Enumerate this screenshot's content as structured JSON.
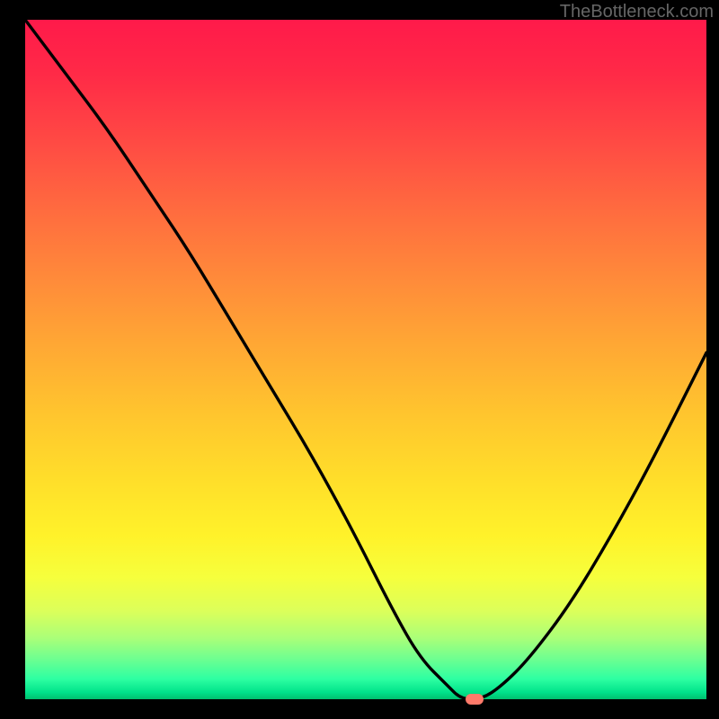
{
  "watermark": "TheBottleneck.com",
  "chart_data": {
    "type": "line",
    "title": "",
    "xlabel": "",
    "ylabel": "",
    "xlim": [
      0,
      100
    ],
    "ylim": [
      0,
      100
    ],
    "grid": false,
    "legend": "none",
    "background_gradient": {
      "direction": "vertical",
      "stops": [
        {
          "pos": 0,
          "color": "#ff1a4a"
        },
        {
          "pos": 50,
          "color": "#ffb030"
        },
        {
          "pos": 80,
          "color": "#fff22a"
        },
        {
          "pos": 95,
          "color": "#6fff90"
        },
        {
          "pos": 100,
          "color": "#00c06e"
        }
      ]
    },
    "series": [
      {
        "name": "bottleneck-curve",
        "color": "#000000",
        "x": [
          0,
          6,
          12,
          18,
          24,
          30,
          36,
          42,
          48,
          54,
          58,
          62,
          64,
          67,
          70,
          74,
          80,
          86,
          92,
          100
        ],
        "y": [
          100,
          92,
          84,
          75,
          66,
          56,
          46,
          36,
          25,
          13,
          6,
          2,
          0,
          0,
          2,
          6,
          14,
          24,
          35,
          51
        ]
      }
    ],
    "marker": {
      "name": "optimum-point",
      "x": 66,
      "y": 0,
      "color": "#ff7a6a"
    }
  }
}
